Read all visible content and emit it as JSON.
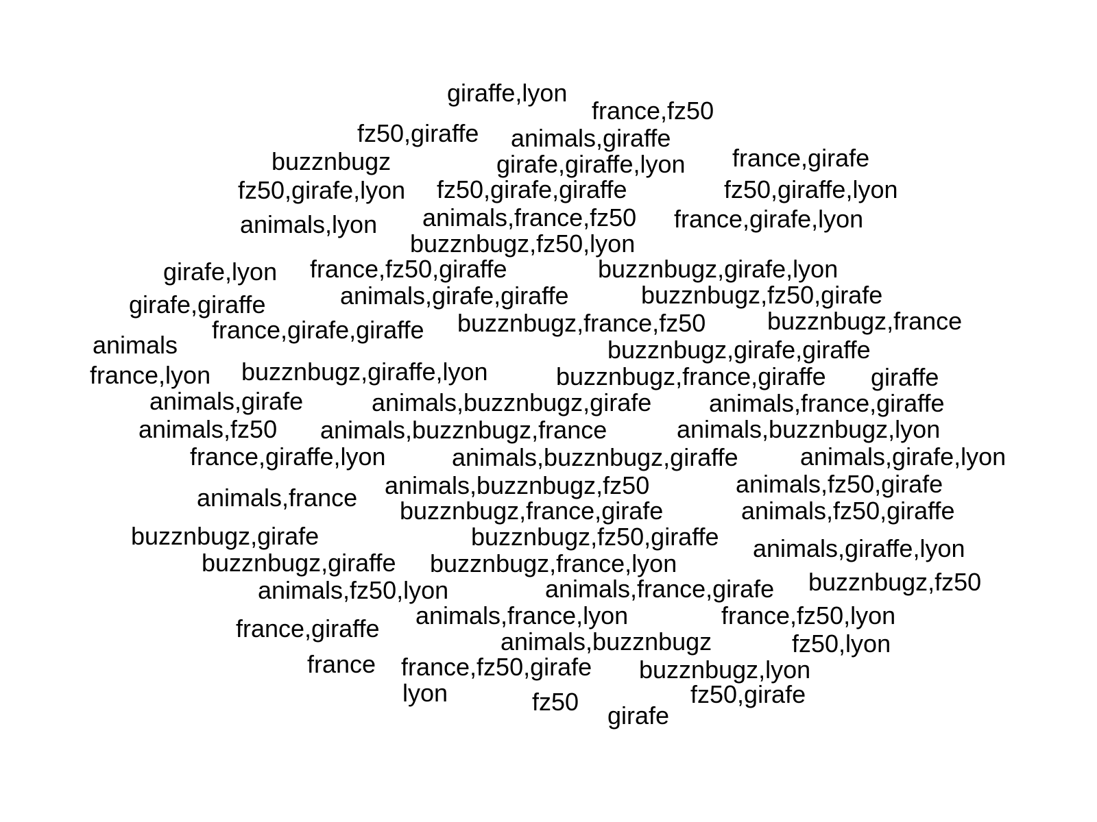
{
  "tags": [
    "giraffe,lyon",
    "france,fz50",
    "fz50,giraffe",
    "animals,giraffe",
    "buzznbugz",
    "girafe,giraffe,lyon",
    "france,girafe",
    "fz50,girafe,lyon",
    "fz50,girafe,giraffe",
    "fz50,giraffe,lyon",
    "animals,lyon",
    "animals,france,fz50",
    "france,girafe,lyon",
    "buzznbugz,fz50,lyon",
    "girafe,lyon",
    "france,fz50,giraffe",
    "buzznbugz,girafe,lyon",
    "animals,girafe,giraffe",
    "buzznbugz,fz50,girafe",
    "girafe,giraffe",
    "france,girafe,giraffe",
    "buzznbugz,france,fz50",
    "buzznbugz,france",
    "animals",
    "buzznbugz,girafe,giraffe",
    "france,lyon",
    "buzznbugz,giraffe,lyon",
    "buzznbugz,france,giraffe",
    "giraffe",
    "animals,girafe",
    "animals,buzznbugz,girafe",
    "animals,france,giraffe",
    "animals,fz50",
    "animals,buzznbugz,france",
    "animals,buzznbugz,lyon",
    "france,giraffe,lyon",
    "animals,buzznbugz,giraffe",
    "animals,girafe,lyon",
    "animals,buzznbugz,fz50",
    "animals,fz50,girafe",
    "animals,france",
    "buzznbugz,france,girafe",
    "animals,fz50,giraffe",
    "buzznbugz,girafe",
    "buzznbugz,fz50,giraffe",
    "animals,giraffe,lyon",
    "buzznbugz,giraffe",
    "buzznbugz,france,lyon",
    "buzznbugz,fz50",
    "animals,fz50,lyon",
    "animals,france,girafe",
    "animals,france,lyon",
    "france,fz50,lyon",
    "france,giraffe",
    "animals,buzznbugz",
    "fz50,lyon",
    "france",
    "france,fz50,girafe",
    "buzznbugz,lyon",
    "lyon",
    "fz50,girafe",
    "fz50",
    "girafe"
  ]
}
